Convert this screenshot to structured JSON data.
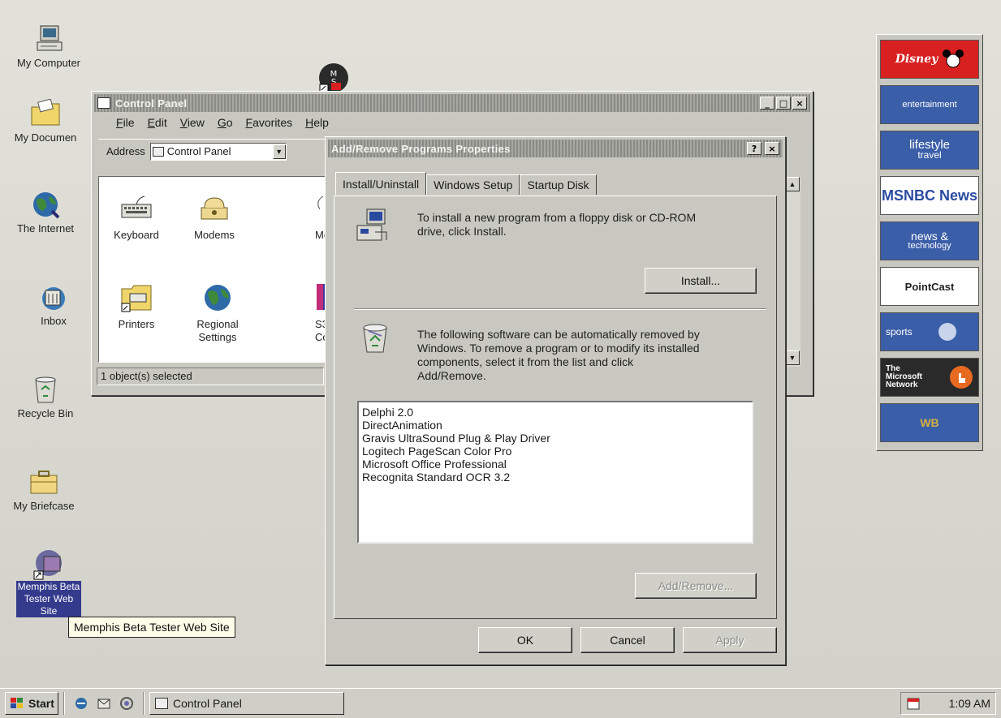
{
  "desktop": {
    "icons": [
      {
        "label": "My Computer",
        "icon": "computer-icon"
      },
      {
        "label": "My Documen",
        "icon": "folder-icon"
      },
      {
        "label": "The Internet",
        "icon": "globe-icon"
      },
      {
        "label": "Inbox",
        "icon": "inbox-icon"
      },
      {
        "label": "Recycle Bin",
        "icon": "recycle-bin-icon"
      },
      {
        "label": "My Briefcase",
        "icon": "briefcase-icon"
      },
      {
        "label": "Memphis Beta Tester Web Site",
        "label_lines": [
          "Memphis Beta",
          "Tester Web",
          "Site"
        ],
        "icon": "web-shortcut-icon"
      }
    ],
    "ms_shortcut_icon": "msn-shortcut-icon"
  },
  "control_panel": {
    "title": "Control Panel",
    "menu": [
      "File",
      "Edit",
      "View",
      "Go",
      "Favorites",
      "Help"
    ],
    "address_label": "Address",
    "address_value": "Control Panel",
    "items": [
      {
        "label": "Keyboard",
        "icon": "keyboard-icon"
      },
      {
        "label": "Modems",
        "icon": "modem-icon"
      },
      {
        "label": "Mo",
        "icon": "mouse-icon"
      },
      {
        "label": "Printers",
        "icon": "printers-icon"
      },
      {
        "label": "Regional Settings",
        "label_lines": [
          "Regional",
          "Settings"
        ],
        "icon": "regional-globe-icon"
      },
      {
        "label": "S3 Co",
        "label_lines": [
          "S3",
          "Co"
        ],
        "icon": "s3-display-icon"
      }
    ],
    "status": "1 object(s) selected"
  },
  "dialog": {
    "title": "Add/Remove Programs Properties",
    "help_btn": "?",
    "close_btn": "×",
    "tabs": [
      "Install/Uninstall",
      "Windows Setup",
      "Startup Disk"
    ],
    "install_text": "To install a new program from a floppy disk or CD-ROM drive, click Install.",
    "install_text_lines": [
      "To install a new program from a floppy disk or CD-ROM",
      "drive, click Install."
    ],
    "install_button": "Install...",
    "remove_text": "The following software can be automatically removed by Windows. To remove a program or to modify its installed components, select it from the list and click Add/Remove.",
    "remove_text_lines": [
      "The following software can be automatically removed by",
      "Windows. To remove a program or to modify its installed",
      "components, select it from the list and click",
      "Add/Remove."
    ],
    "programs": [
      "Delphi 2.0",
      "DirectAnimation",
      "Gravis UltraSound Plug & Play Driver",
      "Logitech PageScan Color Pro",
      "Microsoft Office Professional",
      "Recognita Standard OCR 3.2"
    ],
    "add_remove_button": "Add/Remove...",
    "ok_button": "OK",
    "cancel_button": "Cancel",
    "apply_button": "Apply"
  },
  "tooltip": "Memphis Beta Tester Web Site",
  "channels": [
    {
      "label": "Disney",
      "color": "#d82020"
    },
    {
      "label": "entertainment",
      "color": "#3b5ea8"
    },
    {
      "label": "lifestyle travel",
      "label_lines": [
        "lifestyle",
        "travel"
      ],
      "color": "#3b5ea8"
    },
    {
      "label": "MSNBC News",
      "color": "#ffffff"
    },
    {
      "label": "news & technology",
      "label_lines": [
        "news &",
        "technology"
      ],
      "color": "#3b5ea8"
    },
    {
      "label": "PointCast",
      "color": "#ffffff"
    },
    {
      "label": "sports",
      "color": "#3b5ea8"
    },
    {
      "label": "The Microsoft Network",
      "label_lines": [
        "The",
        "Microsoft",
        "Network"
      ],
      "color": "#2a2a2a"
    },
    {
      "label": "WB",
      "color": "#3b5ea8"
    }
  ],
  "taskbar": {
    "start_label": "Start",
    "quick_launch": [
      "ie-icon",
      "outlook-icon",
      "channels-icon"
    ],
    "task": "Control Panel",
    "clock": "1:09 AM"
  }
}
